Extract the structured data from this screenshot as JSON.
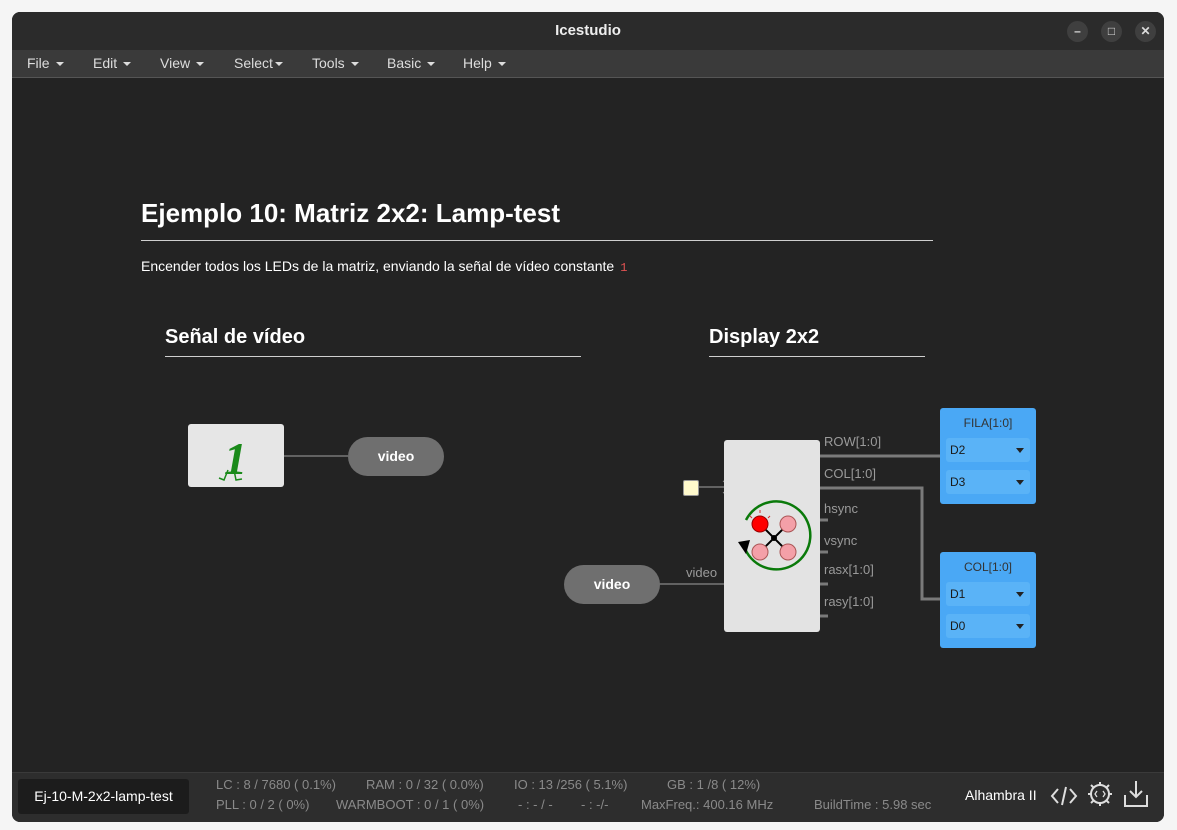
{
  "window": {
    "title": "Icestudio"
  },
  "menu": [
    {
      "label": "File"
    },
    {
      "label": "Edit"
    },
    {
      "label": "View"
    },
    {
      "label": "Select"
    },
    {
      "label": "Tools"
    },
    {
      "label": "Basic"
    },
    {
      "label": "Help"
    }
  ],
  "canvas": {
    "title": "Ejemplo 10: Matriz 2x2: Lamp-test",
    "description": "Encender todos los LEDs de la matriz, enviando la señal de vídeo constante",
    "description_code": "1",
    "section_left": "Señal de vídeo",
    "section_right": "Display 2x2",
    "constant_value": "1",
    "label_video_out": "video",
    "label_video_in": "video",
    "wire_label_video": "video",
    "matrix_ports": [
      "ROW[1:0]",
      "COL[1:0]",
      "hsync",
      "vsync",
      "rasx[1:0]",
      "rasy[1:0]"
    ],
    "outputs": [
      {
        "title": "FILA[1:0]",
        "pins": [
          "D2",
          "D3"
        ]
      },
      {
        "title": "COL[1:0]",
        "pins": [
          "D1",
          "D0"
        ]
      }
    ]
  },
  "footer": {
    "file_name": "Ej-10-M-2x2-lamp-test",
    "stats_row1": [
      "LC : 8 / 7680 ( 0.1%)",
      "RAM : 0 / 32 ( 0.0%)",
      "IO : 13 /256 ( 5.1%)",
      "GB : 1 /8 ( 12%)"
    ],
    "stats_row2": [
      "PLL : 0 / 2 ( 0%)",
      "WARMBOOT : 0 / 1 ( 0%)",
      "- : - / -",
      "- : -/-",
      "MaxFreq.: 400.16 MHz",
      "BuildTime : 5.98 sec"
    ],
    "board": "Alhambra II"
  },
  "colors": {
    "output_block": "#4aa8f5",
    "background": "#232323",
    "pill": "#6f6f6f",
    "led_on": "#ff0000",
    "led_off": "#f4a0a8"
  },
  "icons": [
    "caret-down-icon",
    "minimize-icon",
    "maximize-icon",
    "close-icon",
    "code-icon",
    "settings-gear-icon",
    "download-icon",
    "led-matrix-icon"
  ]
}
